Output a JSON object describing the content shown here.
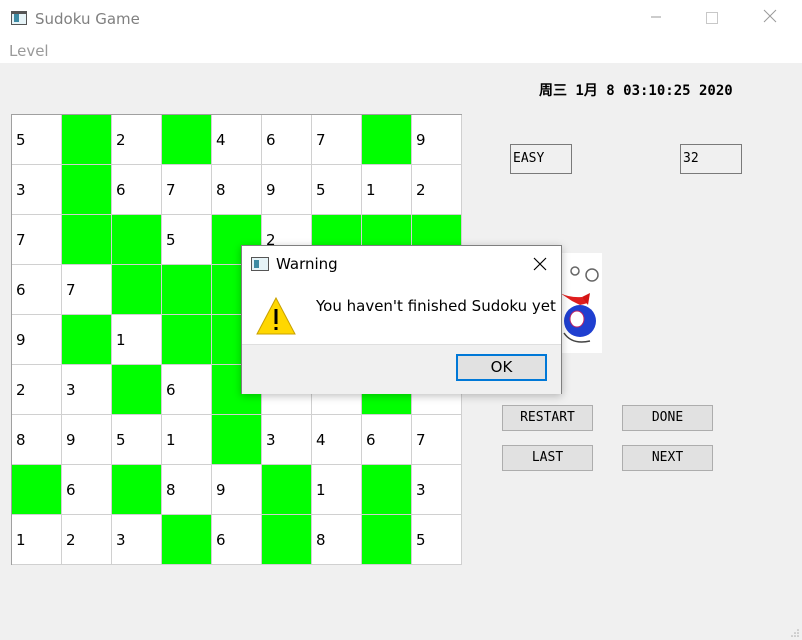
{
  "window": {
    "title": "Sudoku Game"
  },
  "menu": {
    "level": "Level"
  },
  "datetime": "周三 1月 8 03:10:25 2020",
  "board": [
    [
      "5",
      "",
      "2",
      "",
      "4",
      "6",
      "7",
      "",
      "9"
    ],
    [
      "3",
      "",
      "6",
      "7",
      "8",
      "9",
      "5",
      "1",
      "2"
    ],
    [
      "7",
      "",
      "",
      "5",
      "",
      "2",
      "",
      "",
      ""
    ],
    [
      "6",
      "7",
      "",
      "",
      "",
      "",
      "",
      "",
      ""
    ],
    [
      "9",
      "",
      "1",
      "",
      "",
      "",
      "",
      "",
      ""
    ],
    [
      "2",
      "3",
      "",
      "6",
      "",
      "",
      "",
      "",
      ""
    ],
    [
      "8",
      "9",
      "5",
      "1",
      "",
      "3",
      "4",
      "6",
      "7"
    ],
    [
      "",
      "6",
      "",
      "8",
      "9",
      "",
      "1",
      "",
      "3"
    ],
    [
      "1",
      "2",
      "3",
      "",
      "6",
      "",
      "8",
      "",
      "5"
    ]
  ],
  "green_cells": [
    [
      0,
      1
    ],
    [
      0,
      3
    ],
    [
      0,
      7
    ],
    [
      1,
      1
    ],
    [
      2,
      1
    ],
    [
      2,
      2
    ],
    [
      2,
      4
    ],
    [
      2,
      6
    ],
    [
      2,
      7
    ],
    [
      2,
      8
    ],
    [
      3,
      2
    ],
    [
      3,
      3
    ],
    [
      3,
      4
    ],
    [
      4,
      1
    ],
    [
      4,
      3
    ],
    [
      4,
      4
    ],
    [
      5,
      2
    ],
    [
      5,
      4
    ],
    [
      5,
      7
    ],
    [
      6,
      4
    ],
    [
      7,
      0
    ],
    [
      7,
      2
    ],
    [
      7,
      5
    ],
    [
      7,
      7
    ],
    [
      8,
      3
    ],
    [
      8,
      5
    ],
    [
      8,
      7
    ]
  ],
  "colors": {
    "green_cell": "#00ff00",
    "accent": "#0078d7"
  },
  "panel": {
    "level_value": "EASY",
    "score_value": "32",
    "restart": "RESTART",
    "done": "DONE",
    "last": "LAST",
    "next": "NEXT"
  },
  "dialog": {
    "title": "Warning",
    "message": "You haven't finished Sudoku yet",
    "ok": "OK",
    "icon": "warning-icon"
  }
}
